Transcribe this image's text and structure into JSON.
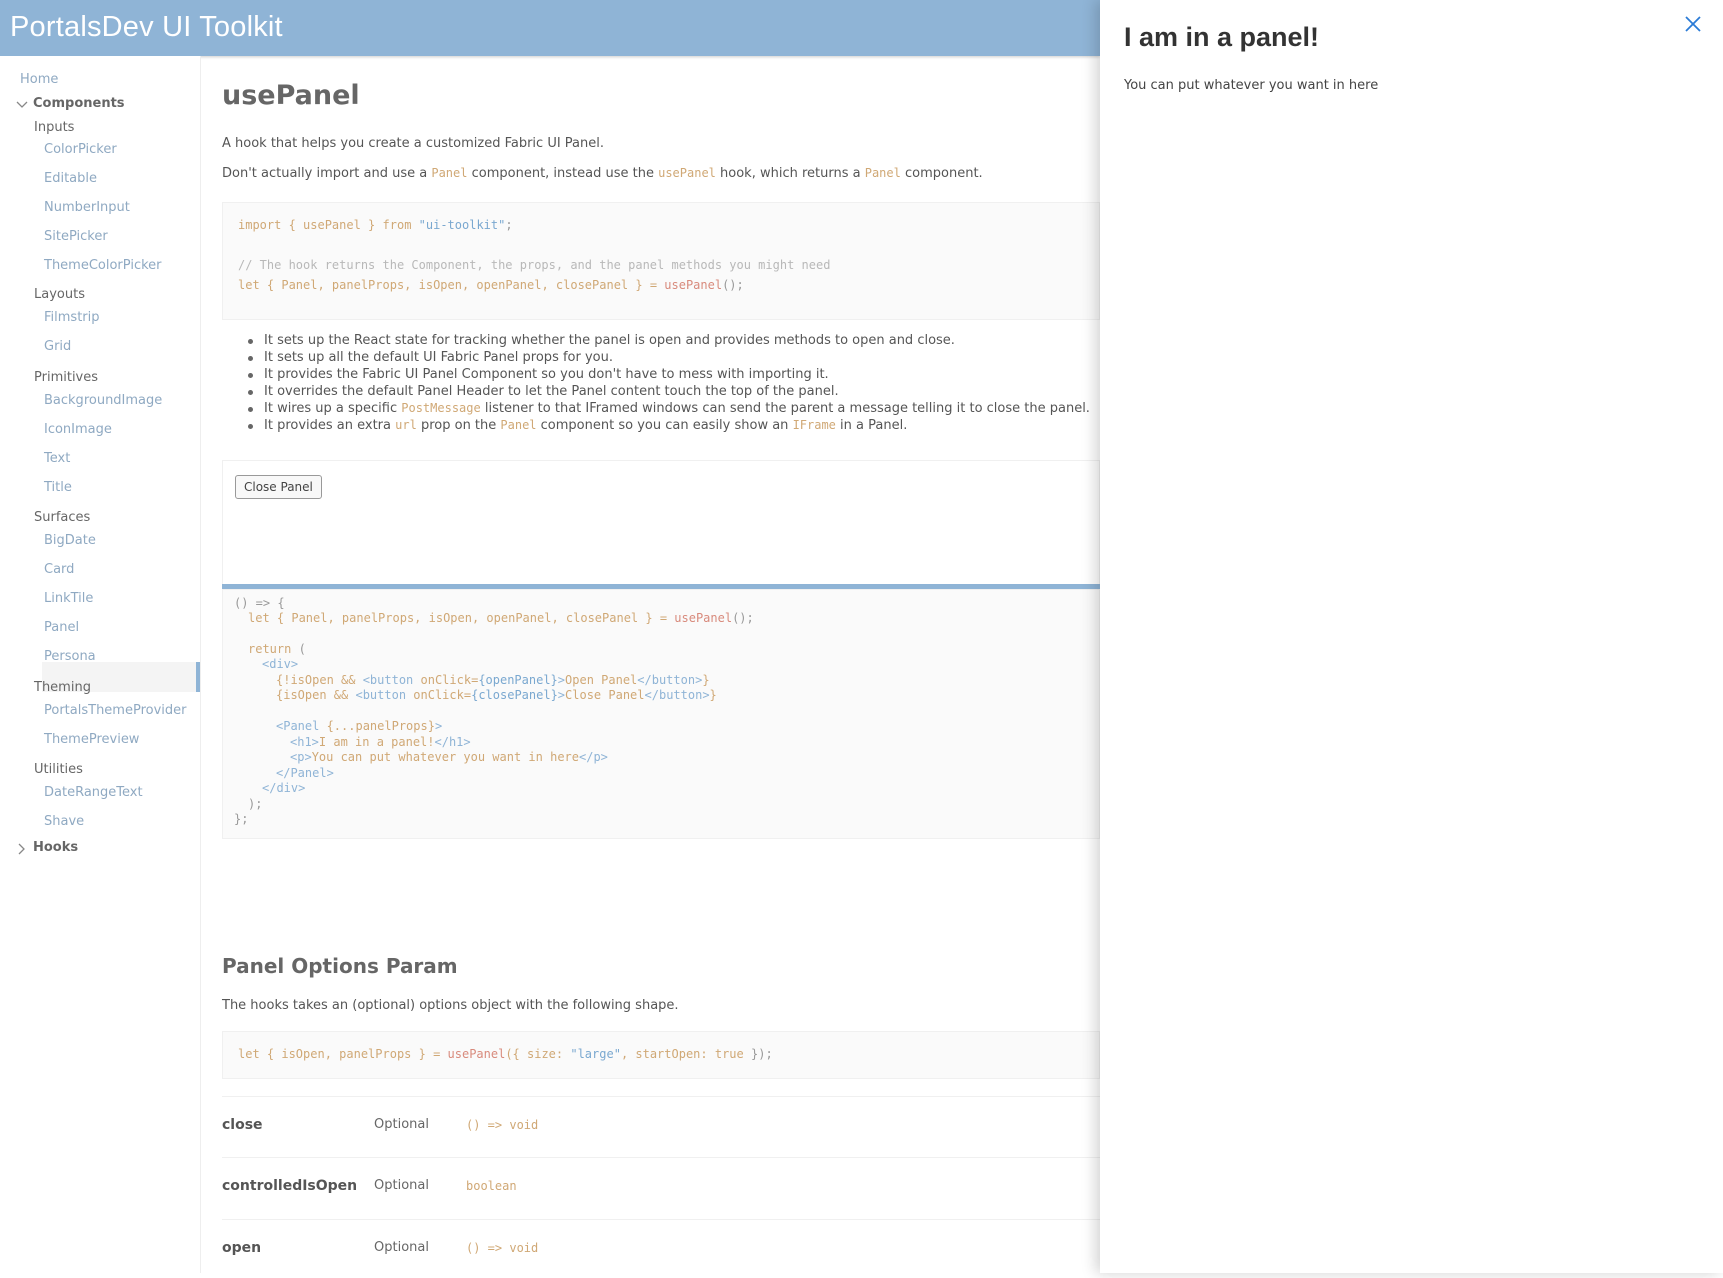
{
  "header": {
    "brand": "PortalsDev UI Toolkit"
  },
  "sidebar": {
    "home": "Home",
    "components": "Components",
    "hooks": "Hooks",
    "sections": [
      {
        "label": "Inputs",
        "items": [
          "ColorPicker",
          "Editable",
          "NumberInput",
          "SitePicker",
          "ThemeColorPicker"
        ]
      },
      {
        "label": "Layouts",
        "items": [
          "Filmstrip",
          "Grid"
        ]
      },
      {
        "label": "Primitives",
        "items": [
          "BackgroundImage",
          "IconImage",
          "Text",
          "Title"
        ]
      },
      {
        "label": "Surfaces",
        "items": [
          "BigDate",
          "Card",
          "LinkTile",
          "Panel",
          "Persona"
        ]
      },
      {
        "label": "Theming",
        "items": [
          "PortalsThemeProvider",
          "ThemePreview"
        ]
      },
      {
        "label": "Utilities",
        "items": [
          "DateRangeText",
          "Shave"
        ]
      }
    ],
    "selected": "Panel"
  },
  "main": {
    "title": "usePanel",
    "intro": "A hook that helps you create a customized Fabric UI Panel.",
    "usage": {
      "p1": "Don't actually import and use a ",
      "c1": "Panel",
      "p2": " component, instead use the ",
      "c2": "usePanel",
      "p3": " hook, which returns a ",
      "c3": "Panel",
      "p4": " component."
    },
    "code1": {
      "import_kw": "import",
      "import_mid": " { usePanel } ",
      "from_kw": "from",
      "import_src": "\"ui-toolkit\"",
      "import_end": ";",
      "comment": "// The hook returns the Component, the props, and the panel methods you might need",
      "let_kw": "let",
      "destructure": " { Panel, panelProps, isOpen, openPanel, closePanel } = ",
      "call": "usePanel",
      "call_end": "();"
    },
    "bullets": [
      {
        "text": "It sets up the React state for tracking whether the panel is open and provides methods to open and close."
      },
      {
        "text": "It sets up all the default UI Fabric Panel props for you."
      },
      {
        "text": "It provides the Fabric UI Panel Component so you don't have to mess with importing it."
      },
      {
        "text": "It overrides the default Panel Header to let the Panel content touch the top of the panel."
      },
      {
        "pre": "It wires up a specific ",
        "code": "PostMessage",
        "post": " listener to that IFramed windows can send the parent a message telling it to close the panel."
      },
      {
        "pre": "It provides an extra ",
        "code": "url",
        "mid": " prop on the ",
        "code2": "Panel",
        "mid2": " component so you can easily show an ",
        "code3": "IFrame",
        "post": " in a Panel."
      }
    ],
    "demo": {
      "close_button": "Close Panel"
    },
    "code2": {
      "l1": "() => {",
      "l2_kw": "let",
      "l2_mid": " { Panel, panelProps, isOpen, openPanel, closePanel } = ",
      "l2_fn": "usePanel",
      "l2_end": "();",
      "l4_kw": "return",
      "l4_end": " (",
      "l5": "<div>",
      "l6_a": "{!isOpen && ",
      "l6_tag": "<button",
      "l6_attr": " onClick=",
      "l6_val": "{openPanel}",
      "l6_close": ">",
      "l6_text": "Open Panel",
      "l6_endtag": "</button>",
      "l6_end": "}",
      "l7_a": "{isOpen && ",
      "l7_tag": "<button",
      "l7_attr": " onClick=",
      "l7_val": "{closePanel}",
      "l7_close": ">",
      "l7_text": "Close Panel",
      "l7_endtag": "</button>",
      "l7_end": "}",
      "l9_tag": "<Panel",
      "l9_spread": " {...panelProps}",
      "l9_close": ">",
      "l10_tag": "<h1>",
      "l10_text": "I am in a panel!",
      "l10_end": "</h1>",
      "l11_tag": "<p>",
      "l11_text": "You can put whatever you want in here",
      "l11_end": "</p>",
      "l12": "</Panel>",
      "l13": "</div>",
      "l14": ");",
      "l15": "};"
    },
    "options": {
      "title": "Panel Options Param",
      "desc": "The hooks takes an (optional) options object with the following shape.",
      "code_kw": "let",
      "code_mid": " { isOpen, panelProps } = ",
      "code_fn": "usePanel",
      "code_a": "({ size: ",
      "code_str": "\"large\"",
      "code_b": ", startOpen: ",
      "code_bool": "true",
      "code_end": " });",
      "props": [
        {
          "name": "close",
          "optional": "Optional",
          "type": "() => void"
        },
        {
          "name": "controlledIsOpen",
          "optional": "Optional",
          "type": "boolean"
        },
        {
          "name": "open",
          "optional": "Optional",
          "type": "() => void"
        }
      ]
    }
  },
  "panel": {
    "title": "I am in a panel!",
    "body": "You can put whatever you want in here",
    "close_icon": "close-icon"
  },
  "colors": {
    "accent": "#8fb4d6",
    "link": "#8fa9c2",
    "code_keyword": "#d0a875",
    "code_string": "#7aa8d0",
    "code_function": "#d88a7c"
  }
}
